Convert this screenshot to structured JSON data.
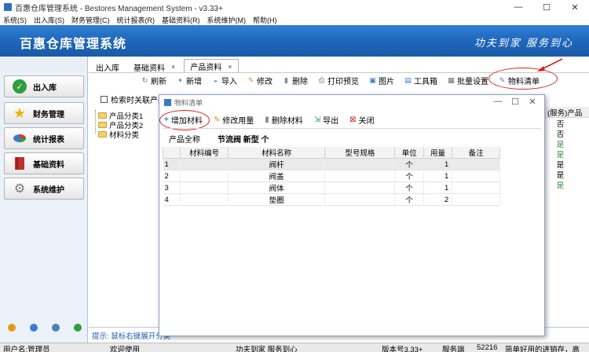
{
  "window": {
    "title": "百惠仓库管理系统 - Bestores Management System - v3.33+",
    "btn_min": "—",
    "btn_max": "☐",
    "btn_close": "✕"
  },
  "menu": [
    "系统(S)",
    "出入库(S)",
    "财务管理(C)",
    "统计报表(R)",
    "基础资料(R)",
    "系统维护(M)",
    "帮助(H)"
  ],
  "banner": {
    "brand": "百惠仓库管理系统",
    "slogan": "功夫到家  服务到心"
  },
  "sidebar": {
    "items": [
      {
        "label": "出入库",
        "icon": "check-icon",
        "color": "#2e9e3e"
      },
      {
        "label": "财务管理",
        "icon": "star-icon",
        "color": "#f0b400"
      },
      {
        "label": "统计报表",
        "icon": "pie-chart-icon",
        "color": "#d33a3a"
      },
      {
        "label": "基础资料",
        "icon": "book-icon",
        "color": "#c0302a"
      },
      {
        "label": "系统维护",
        "icon": "gear-icon",
        "color": "#7a7a7a"
      }
    ]
  },
  "tabs": [
    {
      "label": "出入库"
    },
    {
      "label": "基础资料",
      "close": "×"
    },
    {
      "label": "产品资料",
      "close": "×"
    }
  ],
  "toolbar": [
    "刷新",
    "新增",
    "导入",
    "修改",
    "删除",
    "打印预览",
    "图片",
    "工具箱",
    "批量设置",
    "物料清单"
  ],
  "search": {
    "label": "检索时关联产品"
  },
  "tree": [
    "产品分类1",
    "产品分类2",
    "材料分类"
  ],
  "right_col": {
    "header": "(服务)产品",
    "values": [
      "否",
      "否",
      "是",
      "是",
      "是",
      "是",
      "是"
    ]
  },
  "status_info": "提示: 鼠标右键展开分类",
  "statusbar": {
    "user": "用户名:管理员",
    "welcome": "欢迎使用",
    "slogan": "功夫到家 服务到心",
    "version": "版本号3.33+",
    "service": "服务端",
    "port": "52216",
    "ad": "简单好用的进销存，高效、"
  },
  "dialog": {
    "title": "物料清单",
    "toolbar": [
      "增加材料",
      "修改用量",
      "删除材料",
      "导出",
      "关闭"
    ],
    "product_label": "产品全称",
    "product_value": "节流阀 新型  个",
    "columns": [
      "材料编号",
      "材料名称",
      "型号规格",
      "单位",
      "用量",
      "备注"
    ],
    "rows": [
      {
        "n": "1",
        "name": "阀杆",
        "unit": "个",
        "qty": "1"
      },
      {
        "n": "2",
        "name": "阀盖",
        "unit": "个",
        "qty": "1"
      },
      {
        "n": "3",
        "name": "阀体",
        "unit": "个",
        "qty": "1"
      },
      {
        "n": "4",
        "name": "垫圈",
        "unit": "个",
        "qty": "2"
      }
    ]
  },
  "colors": {
    "brand_blue": "#1d63b7",
    "highlight": "#d42020",
    "status_text": "#1e5bb0"
  }
}
